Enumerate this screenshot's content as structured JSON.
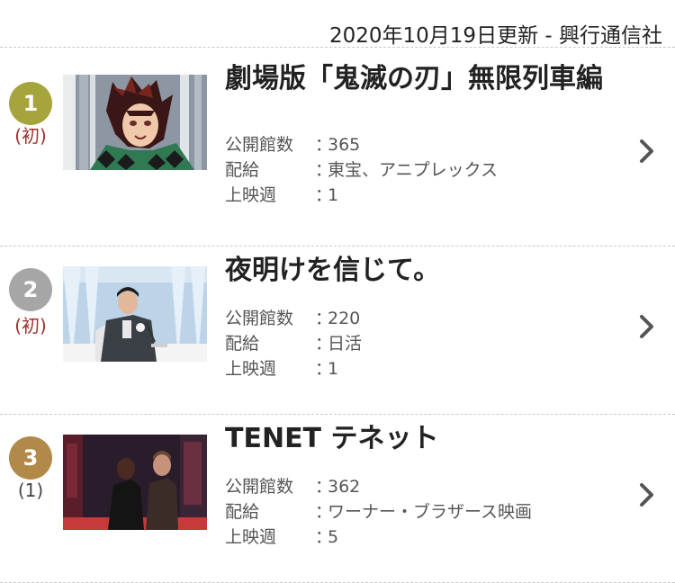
{
  "header": {
    "update_text": "2020年10月19日更新 - 興行通信社"
  },
  "items": [
    {
      "rank": "1",
      "prev": "(初)",
      "title": "劇場版「鬼滅の刃」無限列車編",
      "labels": {
        "theaters": "公開館数",
        "distributor": "配給",
        "weeks": "上映週"
      },
      "colon": "：",
      "theaters": "365",
      "distributor": "東宝、アニプレックス",
      "weeks": "1",
      "rank_color": "#a6a43c",
      "prev_color": "#a0312c"
    },
    {
      "rank": "2",
      "prev": "(初)",
      "title": "夜明けを信じて。",
      "labels": {
        "theaters": "公開館数",
        "distributor": "配給",
        "weeks": "上映週"
      },
      "colon": "：",
      "theaters": "220",
      "distributor": "日活",
      "weeks": "1",
      "rank_color": "#a6a6a6",
      "prev_color": "#a0312c"
    },
    {
      "rank": "3",
      "prev": "(1)",
      "title": "TENET テネット",
      "labels": {
        "theaters": "公開館数",
        "distributor": "配給",
        "weeks": "上映週"
      },
      "colon": "：",
      "theaters": "362",
      "distributor": "ワーナー・ブラザース映画",
      "weeks": "5",
      "rank_color": "#b18a4a",
      "prev_color": "#444444"
    }
  ]
}
